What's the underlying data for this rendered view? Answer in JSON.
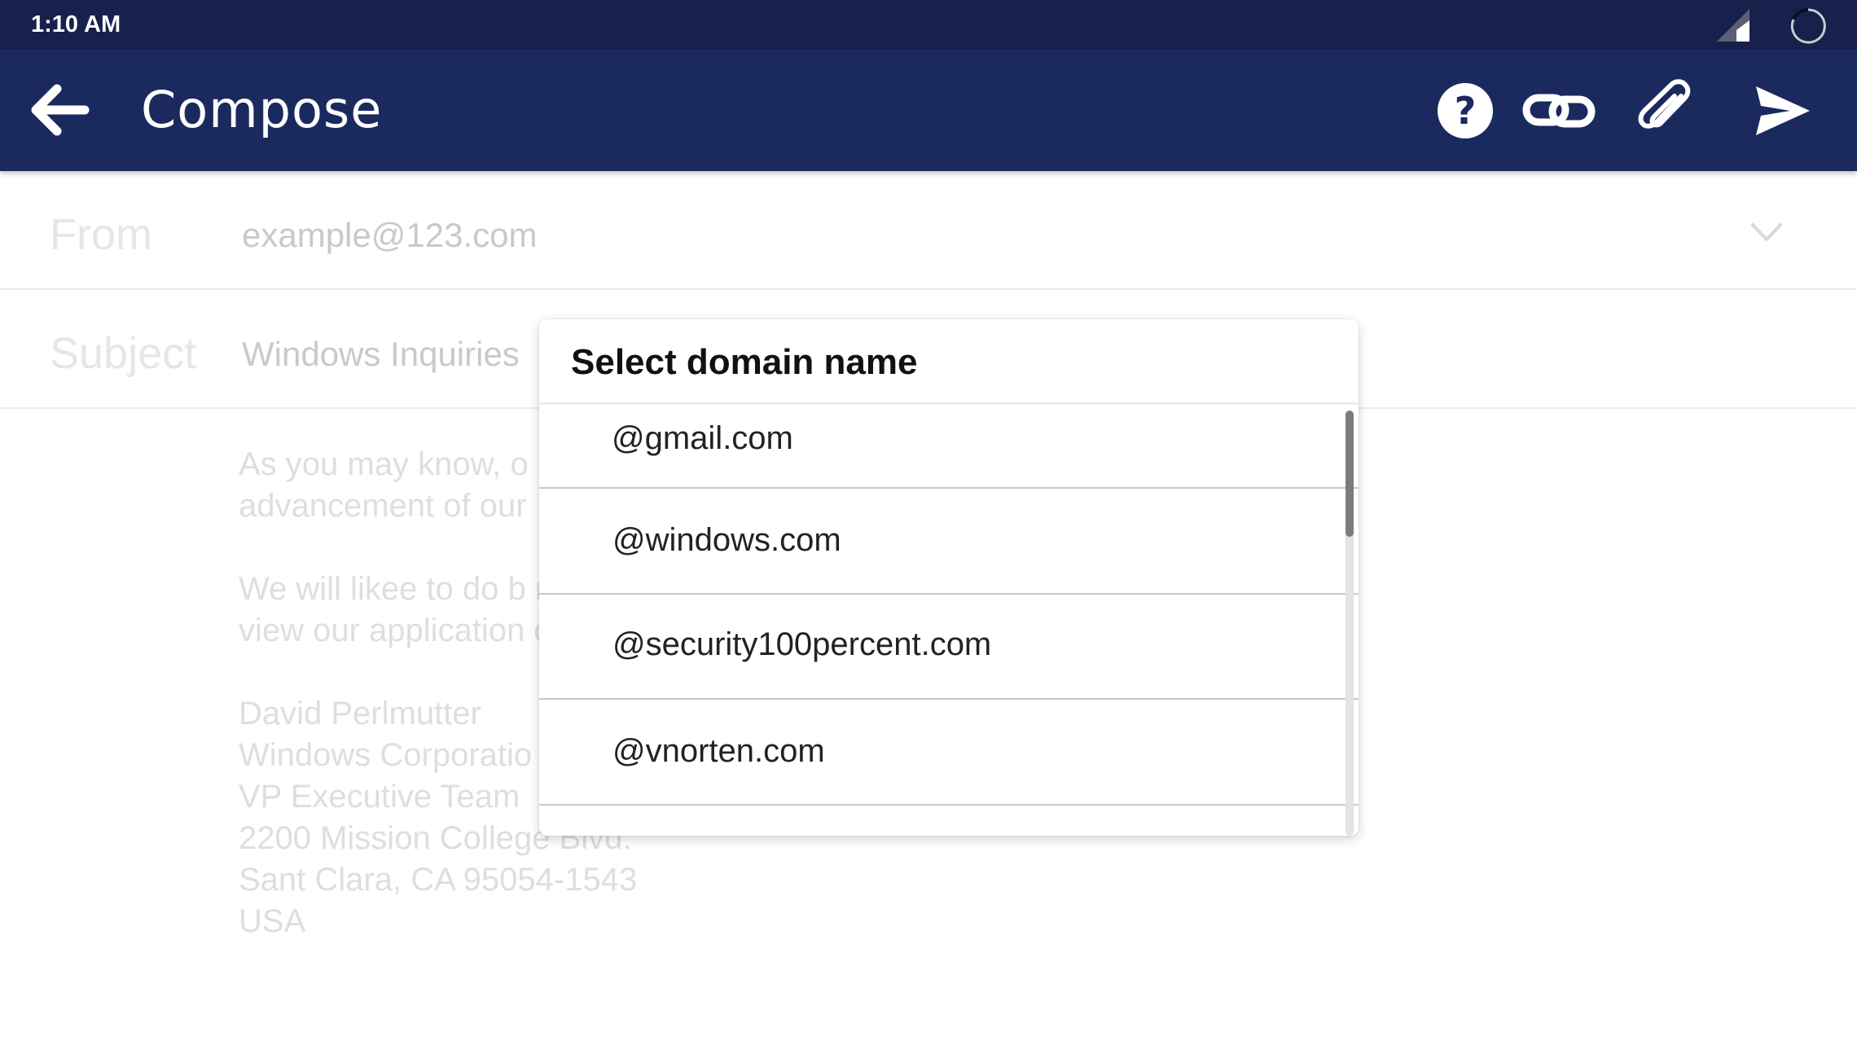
{
  "status_bar": {
    "time": "1:10 AM",
    "icons": [
      "signal-icon",
      "loading-circle-icon"
    ]
  },
  "app_bar": {
    "back_icon": "arrow-left-icon",
    "title": "Compose",
    "actions": [
      {
        "name": "help",
        "icon": "question-circle-icon"
      },
      {
        "name": "link",
        "icon": "link-icon"
      },
      {
        "name": "attach",
        "icon": "paperclip-icon"
      },
      {
        "name": "send",
        "icon": "send-icon"
      }
    ],
    "background": "#1b2a5e"
  },
  "form": {
    "from_label": "From",
    "from_value": "example@123.com",
    "subject_label": "Subject",
    "subject_value": "Windows Inquiries"
  },
  "body": {
    "paragraph_1": "As you may know, o                                                     pporting sustaining and\nadvancement of our",
    "paragraph_2": "We will likee to do b                                                     ndly check attachment to\nview our application                                                     ons.",
    "signature": [
      "David Perlmutter",
      "Windows Corporatio",
      "VP Executive Team",
      "2200 Mission College Blvd.",
      "Sant Clara, CA 95054-1543",
      "USA"
    ]
  },
  "dialog": {
    "title": "Select domain name",
    "options": [
      "@gmail.com",
      "@windows.com",
      "@security100percent.com",
      "@vnorten.com"
    ]
  },
  "colors": {
    "status_bar": "#18214b",
    "app_bar": "#1b2a5e"
  }
}
